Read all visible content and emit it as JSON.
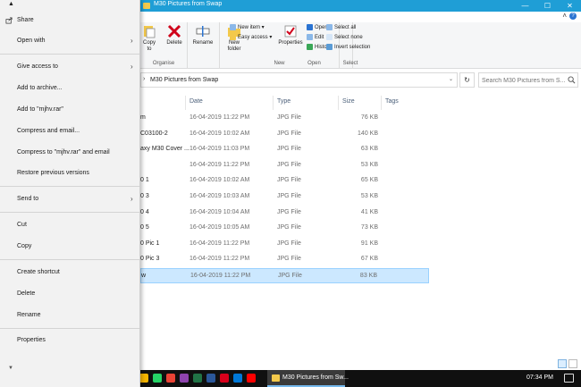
{
  "window": {
    "title": "M30 Pictures from Swap",
    "minimize_glyph": "—",
    "maximize_glyph": "☐",
    "close_glyph": "✕",
    "collapse_glyph": "˄",
    "help_glyph": "?"
  },
  "ribbon": {
    "clipboard": {
      "copy": "Copy to",
      "label": "Organise"
    },
    "delete": "Delete",
    "rename": "Rename",
    "new_folder": "New folder",
    "new_item": "New item ▾",
    "easy_access": "Easy access ▾",
    "new_label": "New",
    "properties": "Properties",
    "open": "Open ▾",
    "edit": "Edit",
    "history": "History",
    "open_label": "Open",
    "select_all": "Select all",
    "select_none": "Select none",
    "invert_selection": "Invert selection",
    "select_label": "Select"
  },
  "address": {
    "path": "M30 Pictures from Swap",
    "refresh_glyph": "↻",
    "search_placeholder": "Search M30 Pictures from S..."
  },
  "columns": {
    "date": "Date",
    "type": "Type",
    "size": "Size",
    "tags": "Tags"
  },
  "files": [
    {
      "name": "m",
      "date": "16-04-2019 11:22 PM",
      "type": "JPG File",
      "size": "76 KB"
    },
    {
      "name": "C03100-2",
      "date": "16-04-2019 10:02 AM",
      "type": "JPG File",
      "size": "140 KB"
    },
    {
      "name": "axy M30 Cover ...",
      "date": "16-04-2019 11:03 PM",
      "type": "JPG File",
      "size": "63 KB"
    },
    {
      "name": "",
      "date": "16-04-2019 11:22 PM",
      "type": "JPG File",
      "size": "53 KB"
    },
    {
      "name": "0 1",
      "date": "16-04-2019 10:02 AM",
      "type": "JPG File",
      "size": "65 KB"
    },
    {
      "name": "0 3",
      "date": "16-04-2019 10:03 AM",
      "type": "JPG File",
      "size": "53 KB"
    },
    {
      "name": "0 4",
      "date": "16-04-2019 10:04 AM",
      "type": "JPG File",
      "size": "41 KB"
    },
    {
      "name": "0 5",
      "date": "16-04-2019 10:05 AM",
      "type": "JPG File",
      "size": "73 KB"
    },
    {
      "name": "0 Pic 1",
      "date": "16-04-2019 11:22 PM",
      "type": "JPG File",
      "size": "91 KB"
    },
    {
      "name": "0 Pic 3",
      "date": "16-04-2019 11:22 PM",
      "type": "JPG File",
      "size": "67 KB"
    },
    {
      "name": "w",
      "date": "16-04-2019 11:22 PM",
      "type": "JPG File",
      "size": "83 KB"
    }
  ],
  "context_menu": {
    "scroll_up": "▲",
    "scroll_down": "▼",
    "share": "Share",
    "open_with": "Open with",
    "give_access_to": "Give access to",
    "add_to_archive": "Add to archive...",
    "add_to_rar": "Add to \"mjhv.rar\"",
    "compress_email": "Compress and email...",
    "compress_rar_email": "Compress to \"mjhv.rar\" and email",
    "restore_versions": "Restore previous versions",
    "send_to": "Send to",
    "cut": "Cut",
    "copy": "Copy",
    "create_shortcut": "Create shortcut",
    "delete": "Delete",
    "rename": "Rename",
    "properties": "Properties",
    "submenu_arrow": "›"
  },
  "taskbar": {
    "active_window": "M30 Pictures from Sw...",
    "time": "07:34 PM",
    "icon_colors": [
      "#ffffff",
      "#1e90ff",
      "#f4b400",
      "#25d366",
      "#ea4335",
      "#8e44ad",
      "#217346",
      "#2b579a",
      "#d9001b",
      "#0078d7",
      "#ff0000"
    ]
  }
}
